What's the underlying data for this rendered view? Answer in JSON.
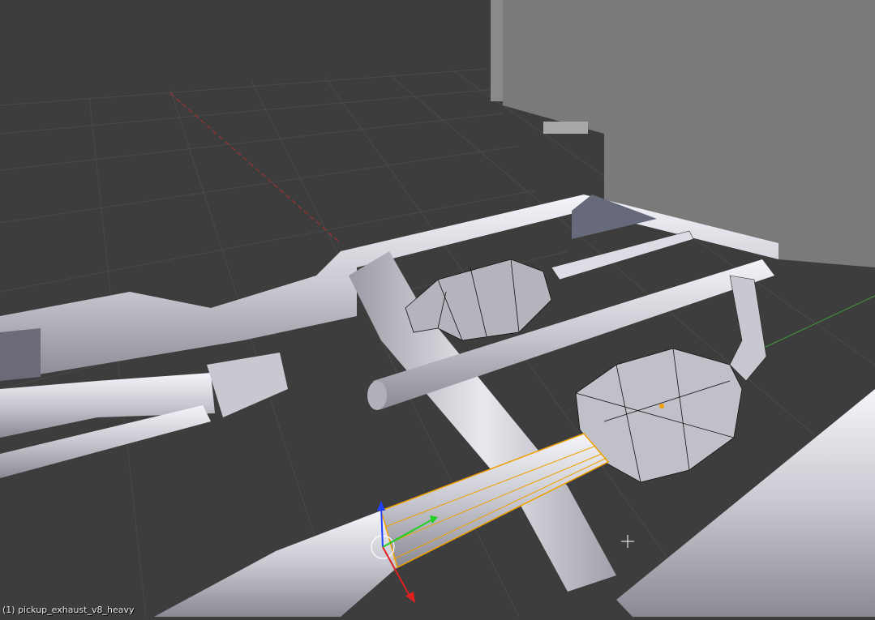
{
  "viewport": {
    "object_label": "(1) pickup_exhaust_v8_heavy",
    "colors": {
      "background": "#3d3d3d",
      "grid": "#4a4a4a",
      "x_axis": "#b03030",
      "y_axis": "#3c9a3c",
      "selection": "#f0a000",
      "gizmo_x": "#e02020",
      "gizmo_y": "#20d020",
      "gizmo_z": "#2040ff"
    }
  }
}
